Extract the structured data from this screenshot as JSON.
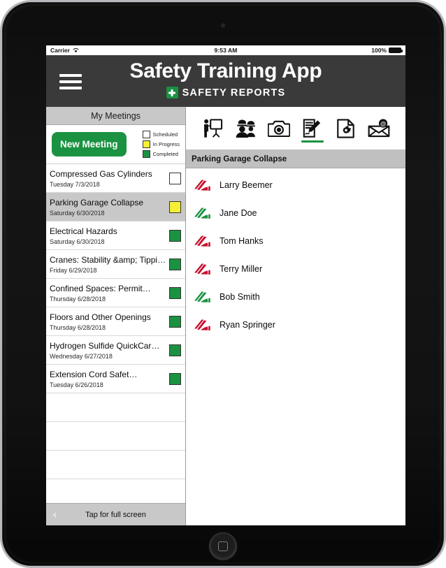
{
  "status_bar": {
    "carrier": "Carrier",
    "wifi_icon": "wifi-icon",
    "time": "9:53 AM",
    "battery_percent": "100%",
    "battery_icon": "battery-full-icon"
  },
  "header": {
    "menu_icon": "hamburger-menu-icon",
    "title": "Safety Training App",
    "brand_logo_icon": "plus-square-logo-icon",
    "brand_text": "SAFETY REPORTS",
    "background_color": "#3a3a3a"
  },
  "sidebar": {
    "title": "My Meetings",
    "new_meeting_label": "New Meeting",
    "accent_color": "#1a9241",
    "legend": [
      {
        "label": "Scheduled",
        "color": "#ffffff"
      },
      {
        "label": "In Progress",
        "color": "#f5f035"
      },
      {
        "label": "Completed",
        "color": "#1a9241"
      }
    ],
    "meetings": [
      {
        "title": "Compressed Gas Cylinders",
        "date": "Tuesday 7/3/2018",
        "status": "Scheduled",
        "status_color": "#ffffff",
        "selected": false
      },
      {
        "title": "Parking Garage Collapse",
        "date": "Saturday 6/30/2018",
        "status": "In Progress",
        "status_color": "#f5f035",
        "selected": true
      },
      {
        "title": "Electrical Hazards",
        "date": "Saturday 6/30/2018",
        "status": "Completed",
        "status_color": "#1a9241",
        "selected": false
      },
      {
        "title": "Cranes: Stability &amp; Tippi…",
        "date": "Friday 6/29/2018",
        "status": "Completed",
        "status_color": "#1a9241",
        "selected": false
      },
      {
        "title": "Confined Spaces: Permit…",
        "date": "Thursday 6/28/2018",
        "status": "Completed",
        "status_color": "#1a9241",
        "selected": false
      },
      {
        "title": "Floors and Other Openings",
        "date": "Thursday 6/28/2018",
        "status": "Completed",
        "status_color": "#1a9241",
        "selected": false
      },
      {
        "title": "Hydrogen Sulfide QuickCar…",
        "date": "Wednesday 6/27/2018",
        "status": "Completed",
        "status_color": "#1a9241",
        "selected": false
      },
      {
        "title": "Extension Cord Safet…",
        "date": "Tuesday 6/26/2018",
        "status": "Completed",
        "status_color": "#1a9241",
        "selected": false
      }
    ],
    "empty_row_count": 4,
    "fullscreen_label": "Tap for full screen",
    "fullscreen_chevron_icon": "chevron-left-icon"
  },
  "detail": {
    "toolbar": [
      {
        "icon": "presenter-whiteboard-icon",
        "active": false
      },
      {
        "icon": "attendees-hardhat-icon",
        "active": false
      },
      {
        "icon": "camera-icon",
        "active": false
      },
      {
        "icon": "signature-form-icon",
        "active": true
      },
      {
        "icon": "document-gear-icon",
        "active": false
      },
      {
        "icon": "email-envelope-icon",
        "active": false
      }
    ],
    "active_underline_color": "#1a9241",
    "title": "Parking Garage Collapse",
    "signature_icon": "signature-mark-icon",
    "signatures": [
      {
        "name": "Larry Beemer",
        "color": "#c8102e"
      },
      {
        "name": "Jane Doe",
        "color": "#1a9241"
      },
      {
        "name": "Tom Hanks",
        "color": "#c8102e"
      },
      {
        "name": "Terry Miller",
        "color": "#c8102e"
      },
      {
        "name": "Bob Smith",
        "color": "#1a9241"
      },
      {
        "name": "Ryan Springer",
        "color": "#c8102e"
      }
    ]
  },
  "device": {
    "home_button_icon": "home-button-icon",
    "camera_icon": "front-camera-icon"
  }
}
